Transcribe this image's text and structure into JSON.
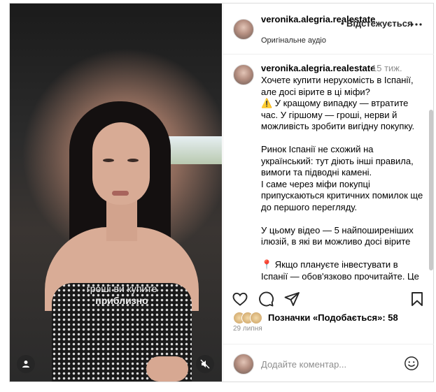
{
  "video": {
    "caption_line1": "гроші ви купите",
    "caption_line2": "приблизно",
    "user_icon": "user-icon",
    "mute_icon": "speaker-muted-icon"
  },
  "header": {
    "username": "veronika.alegria.realestate",
    "separator": "•",
    "follow_label": "Відстежується",
    "subtitle": "Оригінальне аудіо",
    "more_icon": "more-horizontal-icon"
  },
  "post": {
    "username": "veronika.alegria.realestate",
    "time": "15 тиж.",
    "lines": [
      "Хочете купити нерухомість в Іспанії, але досі вірите в ці міфи?",
      "⚠️ У кращому випадку — втратите час. У гіршому — гроші, нерви й можливість зробити вигідну покупку.",
      "",
      "Ринок Іспанії не схожий на український: тут діють інші правила, вимоги та підводні камені.",
      "І саме через міфи покупці припускаються критичних помилок ще до першого перегляду.",
      "",
      "У цьому відео — 5 найпоширеніших ілюзій, в які ви можливо досі вірите",
      "",
      "📍 Якщо плануєте інвестувати в Іспанії — обов'язково прочитайте. Це"
    ]
  },
  "actions": {
    "like_icon": "heart-icon",
    "comment_icon": "comment-icon",
    "share_icon": "share-icon",
    "save_icon": "bookmark-icon"
  },
  "likes": {
    "text": "Позначки «Подобається»: 58"
  },
  "date": "29 липня",
  "comment": {
    "placeholder": "Додайте коментар...",
    "emoji_icon": "smile-icon"
  },
  "colors": {
    "border": "#dbdbdb",
    "muted_text": "#8e8e8e",
    "text": "#000000"
  }
}
